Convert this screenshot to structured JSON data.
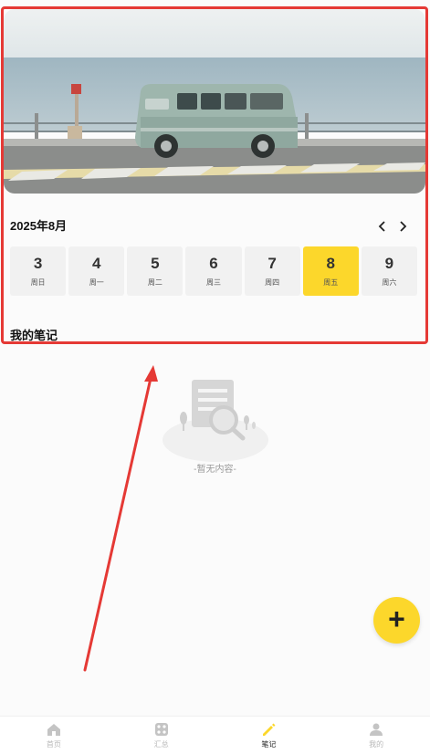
{
  "calendar": {
    "month_label": "2025年8月",
    "days": [
      {
        "day": "3",
        "weekday": "周日",
        "active": false
      },
      {
        "day": "4",
        "weekday": "周一",
        "active": false
      },
      {
        "day": "5",
        "weekday": "周二",
        "active": false
      },
      {
        "day": "6",
        "weekday": "周三",
        "active": false
      },
      {
        "day": "7",
        "weekday": "周四",
        "active": false
      },
      {
        "day": "8",
        "weekday": "周五",
        "active": true
      },
      {
        "day": "9",
        "weekday": "周六",
        "active": false
      }
    ]
  },
  "notes": {
    "section_title": "我的笔记",
    "empty_text": "-暂无内容-"
  },
  "fab": {
    "icon": "plus-icon",
    "label": "+"
  },
  "tabbar": {
    "tabs": [
      {
        "label": "首页",
        "icon": "home-icon",
        "active": false
      },
      {
        "label": "汇总",
        "icon": "grid-icon",
        "active": false
      },
      {
        "label": "笔记",
        "icon": "pencil-icon",
        "active": true
      },
      {
        "label": "我的",
        "icon": "user-icon",
        "active": false
      }
    ]
  },
  "colors": {
    "accent": "#fcd72b",
    "highlight": "#e53935",
    "text": "#222222"
  }
}
